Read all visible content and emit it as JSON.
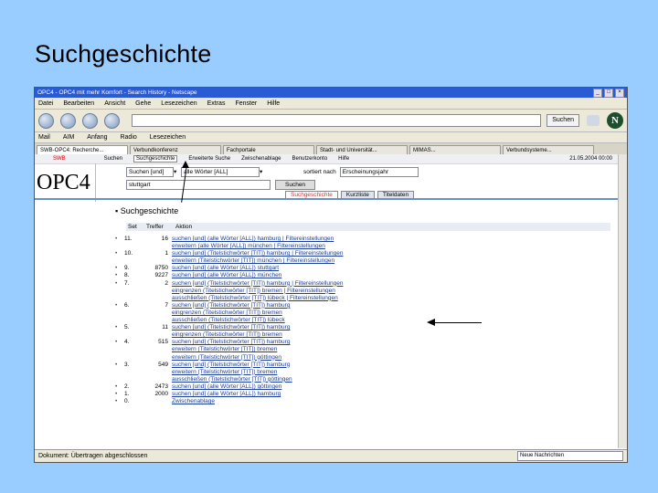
{
  "slide": {
    "title": "Suchgeschichte"
  },
  "browser": {
    "title": "OPC4 - OPC4 mit mehr Komfort - Search History - Netscape",
    "menu": [
      "Datei",
      "Bearbeiten",
      "Ansicht",
      "Gehe",
      "Lesezeichen",
      "Extras",
      "Fenster",
      "Hilfe"
    ],
    "search_button": "Suchen",
    "personal_toolbar": [
      "Mail",
      "AIM",
      "Anfang",
      "Radio",
      "Lesezeichen"
    ],
    "tabs": [
      "SWB-OPC4: Recherche...",
      "Verbundkonferenz",
      "Fachportale",
      "Stadt- und Universität...",
      "MIMAS...",
      "Verbundsysteme..."
    ],
    "status_text": "Dokument: Übertragen abgeschlossen",
    "status_right": "Neue Nachrichten"
  },
  "opc": {
    "logo": "OPC4",
    "top_left": "SWB",
    "menu": [
      "Suchen",
      "Suchgeschichte",
      "Erweiterte Suche",
      "Zwischenablage",
      "Benutzerkonto",
      "Hilfe"
    ],
    "selected_menu": "Suchgeschichte",
    "date": "21.05.2004 00:00",
    "search_field_select": "Suchen [und]",
    "search_index_select": "alle Wörter [ALL]",
    "search_term": "stuttgart",
    "search_button": "Suchen",
    "sort_label": "sortiert nach",
    "sort_value": "Erscheinungsjahr",
    "subtabs": [
      "Suchgeschichte",
      "Kurzliste",
      "Titeldaten"
    ],
    "history_title": "Suchgeschichte",
    "table_headers": [
      "Set",
      "Treffer",
      "Aktion"
    ],
    "rows": [
      {
        "set": "11.",
        "count": "16",
        "action": "suchen [und] (alle Wörter [ALL]) hamburg | Filtereinstellungen"
      },
      {
        "set": "",
        "count": "",
        "action": "erweitern (alle Wörter [ALL]) münchen | Filtereinstellungen"
      },
      {
        "set": "10.",
        "count": "1",
        "action": "suchen [und] (Titelstichwörter [TIT]) hamburg | Filtereinstellungen"
      },
      {
        "set": "",
        "count": "",
        "action": "erweitern (Titelstichwörter [TIT]) münchen | Filtereinstellungen"
      },
      {
        "set": "9.",
        "count": "8750",
        "action": "suchen [und] (alle Wörter [ALL]) stuttgart"
      },
      {
        "set": "8.",
        "count": "9227",
        "action": "suchen [und] (alle Wörter [ALL]) münchen"
      },
      {
        "set": "7.",
        "count": "2",
        "action": "suchen [und] (Titelstichwörter [TIT]) hamburg | Filtereinstellungen"
      },
      {
        "set": "",
        "count": "",
        "action": "eingrenzen (Titelstichwörter [TIT]) bremen | Filtereinstellungen"
      },
      {
        "set": "",
        "count": "",
        "action": "ausschließen (Titelstichwörter [TIT]) lübeck | Filtereinstellungen"
      },
      {
        "set": "6.",
        "count": "7",
        "action": "suchen [und] (Titelstichwörter [TIT]) hamburg"
      },
      {
        "set": "",
        "count": "",
        "action": "eingrenzen (Titelstichwörter [TIT]) bremen"
      },
      {
        "set": "",
        "count": "",
        "action": "ausschließen (Titelstichwörter [TIT]) lübeck"
      },
      {
        "set": "5.",
        "count": "11",
        "action": "suchen [und] (Titelstichwörter [TIT]) hamburg"
      },
      {
        "set": "",
        "count": "",
        "action": "eingrenzen (Titelstichwörter [TIT]) bremen"
      },
      {
        "set": "4.",
        "count": "515",
        "action": "suchen [und] (Titelstichwörter [TIT]) hamburg"
      },
      {
        "set": "",
        "count": "",
        "action": "erweitern (Titelstichwörter [TIT]) bremen"
      },
      {
        "set": "",
        "count": "",
        "action": "erweitern (Titelstichwörter [TIT]) göttingen"
      },
      {
        "set": "3.",
        "count": "549",
        "action": "suchen [und] (Titelstichwörter [TIT]) hamburg"
      },
      {
        "set": "",
        "count": "",
        "action": "erweitern (Titelstichwörter [TIT]) bremen"
      },
      {
        "set": "",
        "count": "",
        "action": "ausschließen (Titelstichwörter [TIT]) göttingen"
      },
      {
        "set": "2.",
        "count": "2473",
        "action": "suchen [und] (alle Wörter [ALL]) göttingen"
      },
      {
        "set": "1.",
        "count": "2000",
        "action": "suchen [und] (alle Wörter [ALL]) hamburg"
      },
      {
        "set": "0.",
        "count": "",
        "action": "Zwischenablage"
      }
    ]
  }
}
